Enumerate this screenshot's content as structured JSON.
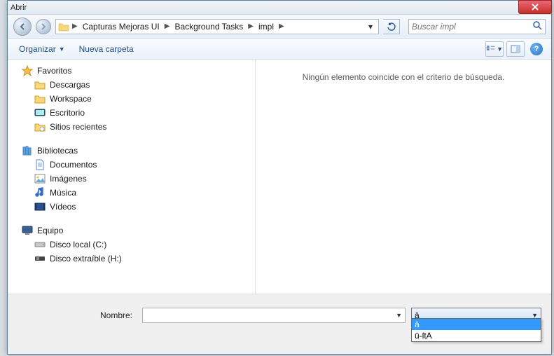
{
  "window": {
    "title": "Abrir"
  },
  "breadcrumb": {
    "items": [
      "Capturas Mejoras UI",
      "Background Tasks",
      "impl"
    ]
  },
  "search": {
    "placeholder": "Buscar impl"
  },
  "toolbar": {
    "organize": "Organizar",
    "new_folder": "Nueva carpeta"
  },
  "sidebar": {
    "favorites": {
      "label": "Favoritos",
      "items": [
        "Descargas",
        "Workspace",
        "Escritorio",
        "Sitios recientes"
      ]
    },
    "libraries": {
      "label": "Bibliotecas",
      "items": [
        "Documentos",
        "Imágenes",
        "Música",
        "Vídeos"
      ]
    },
    "computer": {
      "label": "Equipo",
      "items": [
        "Disco local (C:)",
        "Disco extraíble (H:)"
      ]
    }
  },
  "main": {
    "empty_message": "Ningún elemento coincide con el criterio de búsqueda."
  },
  "bottom": {
    "name_label": "Nombre:",
    "name_value": "",
    "filter_selected": "ā",
    "filter_options": [
      "ā",
      "ū-ſtA"
    ]
  }
}
